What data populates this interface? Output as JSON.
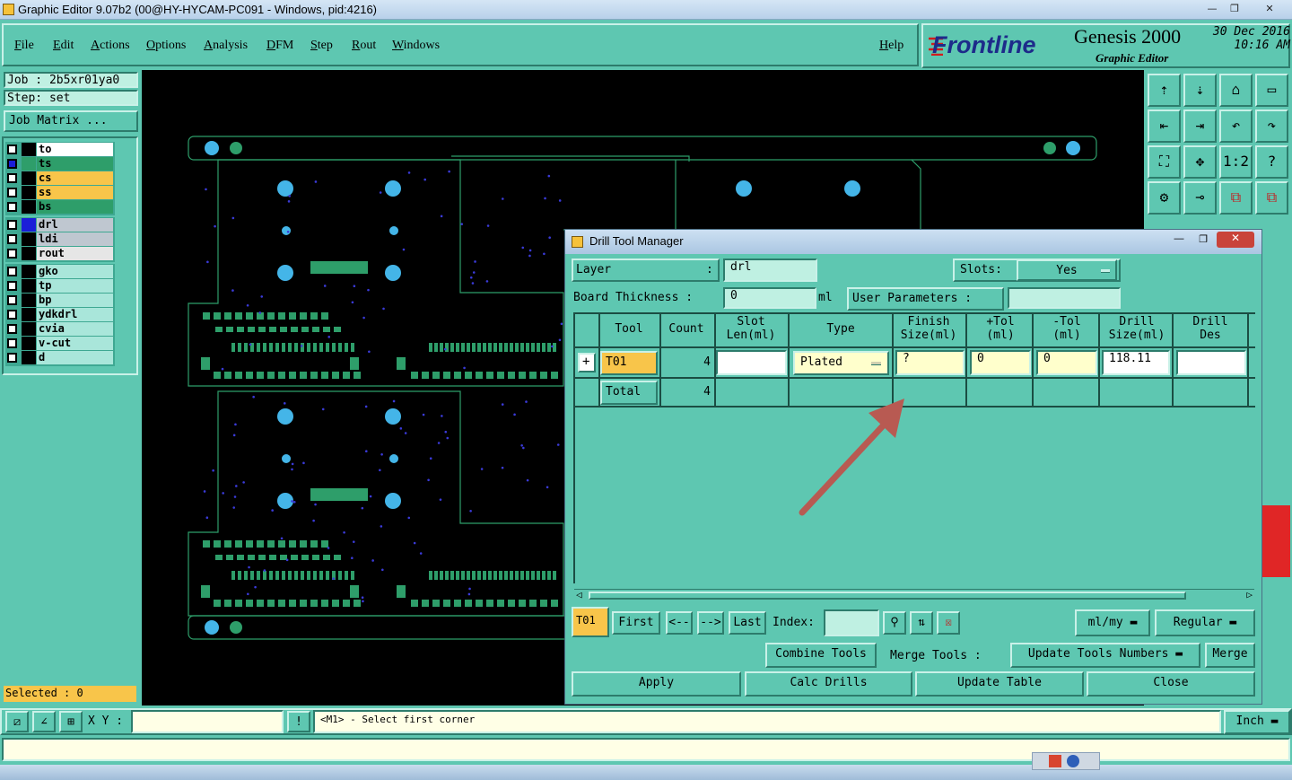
{
  "window": {
    "title": "Graphic Editor 9.07b2 (00@HY-HYCAM-PC091 - Windows, pid:4216)",
    "controls": [
      "—",
      "❐",
      "✕"
    ]
  },
  "menu": {
    "items": [
      "File",
      "Edit",
      "Actions",
      "Options",
      "Analysis",
      "DFM",
      "Step",
      "Rout",
      "Windows"
    ],
    "help": "Help"
  },
  "logo": {
    "brand": "Frontline",
    "product": "Genesis 2000",
    "subtitle": "Graphic Editor",
    "date": "30 Dec 2016",
    "time": "10:16 AM"
  },
  "left_panel": {
    "job": "Job : 2b5xr01ya0",
    "step": "Step: set",
    "job_matrix": "Job Matrix ...",
    "layer_groups": [
      [
        {
          "name": "to",
          "color": "#ffffff",
          "swatch": "#000000",
          "selected": false
        },
        {
          "name": "ts",
          "color": "#2e9e6a",
          "swatch": "#2e9e6a",
          "selected": true
        },
        {
          "name": "cs",
          "color": "#f8c54a",
          "swatch": "#000000",
          "selected": false
        },
        {
          "name": "ss",
          "color": "#f8c54a",
          "swatch": "#000000",
          "selected": false
        },
        {
          "name": "bs",
          "color": "#2e9e6a",
          "swatch": "#000000",
          "selected": false
        }
      ],
      [
        {
          "name": "drl",
          "color": "#bfc7d0",
          "swatch": "#1b1ed8",
          "selected": false
        },
        {
          "name": "ldi",
          "color": "#bfc7d0",
          "swatch": "#000000",
          "selected": false
        },
        {
          "name": "rout",
          "color": "#e6e6e6",
          "swatch": "#000000",
          "selected": false
        }
      ],
      [
        {
          "name": "gko",
          "color": "#a9e6da",
          "swatch": "#000000",
          "selected": false
        },
        {
          "name": "tp",
          "color": "#a9e6da",
          "swatch": "#000000",
          "selected": false
        },
        {
          "name": "bp",
          "color": "#a9e6da",
          "swatch": "#000000",
          "selected": false
        },
        {
          "name": "ydkdrl",
          "color": "#a9e6da",
          "swatch": "#000000",
          "selected": false
        },
        {
          "name": "cvia",
          "color": "#a9e6da",
          "swatch": "#000000",
          "selected": false
        },
        {
          "name": "v-cut",
          "color": "#a9e6da",
          "swatch": "#000000",
          "selected": false
        },
        {
          "name": "d",
          "color": "#a9e6da",
          "swatch": "#000000",
          "selected": false
        }
      ]
    ],
    "selected": "Selected : 0"
  },
  "right_toolbar": {
    "buttons": [
      "page-up-icon",
      "page-down-icon",
      "home-icon",
      "window-icon",
      "pan-left-icon",
      "pan-right-icon",
      "undo-zoom-icon",
      "redo-zoom-icon",
      "fit-icon",
      "zoom-center-icon",
      "ratio-1-2-icon",
      "help-icon",
      "measure-icon",
      "snap-icon",
      "layer-compare-icon",
      "layer-compare-alt-icon"
    ]
  },
  "command_bar": {
    "xy_label": "X Y :",
    "xy_value": "",
    "message": "<M1> - Select first corner",
    "units": "Inch"
  },
  "dialog": {
    "title": "Drill Tool Manager",
    "layer_label": "Layer",
    "layer_colon": ":",
    "layer_value": "drl",
    "slots_label": "Slots:",
    "slots_value": "Yes",
    "board_thickness_label": "Board Thickness :",
    "board_thickness_value": "0",
    "board_thickness_unit": "ml",
    "user_params_label": "User Parameters :",
    "user_params_value": "",
    "columns": [
      "Tool",
      "Count",
      "Slot\nLen(ml)",
      "Type",
      "Finish\nSize(ml)",
      "+Tol\n(ml)",
      "-Tol\n(ml)",
      "Drill\nSize(ml)",
      "Drill\nDes"
    ],
    "rows": [
      {
        "tool": "T01",
        "count": "4",
        "slot_len": "",
        "type": "Plated",
        "finish": "?",
        "plus_tol": "0",
        "minus_tol": "0",
        "drill_size": "118.11",
        "drill_des": ""
      }
    ],
    "total_label": "Total",
    "total_count": "4",
    "nav": {
      "current": "T01",
      "first": "First",
      "prev": "<--",
      "next": "-->",
      "last": "Last",
      "index_label": "Index:",
      "index_value": "",
      "units": "ml/my",
      "mode": "Regular"
    },
    "tools": {
      "combine": "Combine Tools",
      "merge_label": "Merge Tools :",
      "merge_option": "Update Tools Numbers",
      "merge": "Merge"
    },
    "actions": {
      "apply": "Apply",
      "calc": "Calc Drills",
      "update": "Update Table",
      "close": "Close"
    }
  }
}
